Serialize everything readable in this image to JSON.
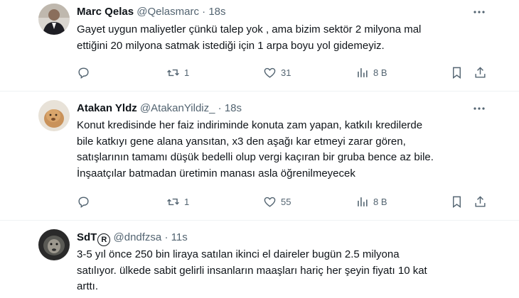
{
  "tweets": [
    {
      "name": "Marc Qelas",
      "handle": "@Qelasmarc",
      "time": "18s",
      "text": [
        "Gayet uygun maliyetler çünkü talep yok , ama bizim sektör 2 milyona mal",
        "ettiğini 20 milyona satmak istediği için 1 arpa boyu yol gidemeyiz."
      ],
      "retweets": "1",
      "likes": "31",
      "views": "8 B"
    },
    {
      "name": "Atakan Yldz",
      "handle": "@AtakanYildiz_",
      "time": "18s",
      "text": [
        "Konut kredisinde her faiz indiriminde konuta zam yapan, katkılı kredilerde",
        "bile katkıyı gene alana yansıtan, x3 den aşağı kar etmeyi zarar gören,",
        "satışlarının tamamı düşük bedelli olup vergi kaçıran bir gruba bence az bile.",
        "İnşaatçılar batmadan üretimin manası asla öğrenilmeyecek"
      ],
      "retweets": "1",
      "likes": "55",
      "views": "8 B"
    },
    {
      "name": "SdT",
      "badge": "R",
      "handle": "@dndfzsa",
      "time": "11s",
      "text": [
        "3-5 yıl önce 250 bin liraya satılan ikinci el  daireler bugün 2.5 milyona",
        "satılıyor. ülkede sabit gelirli insanların maaşları hariç her şeyin fiyatı 10 kat",
        "arttı."
      ]
    }
  ],
  "separator": "·",
  "icons": {
    "more": "more-horizontal-icon",
    "reply": "reply-icon",
    "retweet": "retweet-icon",
    "like": "heart-icon",
    "views": "views-chart-icon",
    "bookmark": "bookmark-icon",
    "share": "share-icon"
  },
  "colors": {
    "text": "#0f1419",
    "muted": "#536471",
    "border": "#eff3f4"
  }
}
